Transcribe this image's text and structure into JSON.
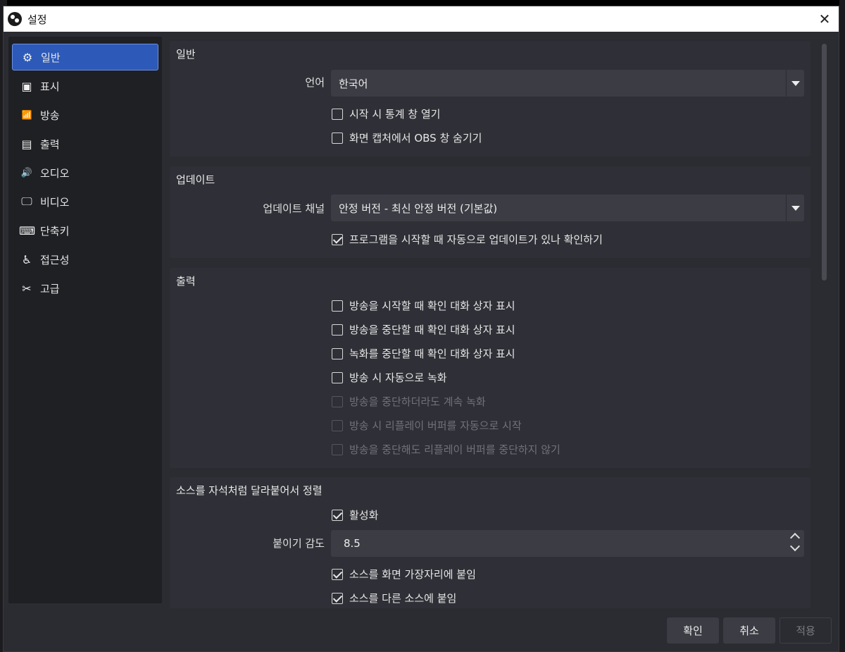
{
  "window": {
    "title": "설정",
    "close_glyph": "✕"
  },
  "sidebar": {
    "items": [
      {
        "label": "일반",
        "icon": "gear-icon",
        "glyph": "⚙",
        "active": true
      },
      {
        "label": "표시",
        "icon": "display-icon",
        "glyph": "▣",
        "active": false
      },
      {
        "label": "방송",
        "icon": "antenna-icon",
        "glyph": "📶",
        "active": false
      },
      {
        "label": "출력",
        "icon": "output-icon",
        "glyph": "▤",
        "active": false
      },
      {
        "label": "오디오",
        "icon": "speaker-icon",
        "glyph": "🔊",
        "active": false
      },
      {
        "label": "비디오",
        "icon": "monitor-icon",
        "glyph": "🖵",
        "active": false
      },
      {
        "label": "단축키",
        "icon": "keyboard-icon",
        "glyph": "⌨",
        "active": false
      },
      {
        "label": "접근성",
        "icon": "accessibility-icon",
        "glyph": "♿",
        "active": false
      },
      {
        "label": "고급",
        "icon": "tools-icon",
        "glyph": "✂",
        "active": false
      }
    ]
  },
  "general": {
    "title": "일반",
    "language_label": "언어",
    "language_value": "한국어",
    "options": [
      {
        "label": "시작 시 통계 창 열기",
        "checked": false
      },
      {
        "label": "화면 캡처에서 OBS 창 숨기기",
        "checked": false
      }
    ]
  },
  "update": {
    "title": "업데이트",
    "channel_label": "업데이트 채널",
    "channel_value": "안정 버전 - 최신 안정 버전 (기본값)",
    "options": [
      {
        "label": "프로그램을 시작할 때 자동으로 업데이트가 있나 확인하기",
        "checked": true
      }
    ]
  },
  "output": {
    "title": "출력",
    "options": [
      {
        "label": "방송을 시작할 때 확인 대화 상자 표시",
        "checked": false,
        "disabled": false
      },
      {
        "label": "방송을 중단할 때 확인 대화 상자 표시",
        "checked": false,
        "disabled": false
      },
      {
        "label": "녹화를 중단할 때 확인 대화 상자 표시",
        "checked": false,
        "disabled": false
      },
      {
        "label": "방송 시 자동으로 녹화",
        "checked": false,
        "disabled": false
      },
      {
        "label": "방송을 중단하더라도 계속 녹화",
        "checked": false,
        "disabled": true
      },
      {
        "label": "방송 시 리플레이 버퍼를 자동으로 시작",
        "checked": false,
        "disabled": true
      },
      {
        "label": "방송을 중단해도 리플레이 버퍼를 중단하지 않기",
        "checked": false,
        "disabled": true
      }
    ]
  },
  "snapping": {
    "title": "소스를 자석처럼 달라붙어서 정렬",
    "enable_label": "활성화",
    "enable_checked": true,
    "sensitivity_label": "붙이기 감도",
    "sensitivity_value": "8.5",
    "options": [
      {
        "label": "소스를 화면 가장자리에 붙임",
        "checked": true
      },
      {
        "label": "소스를 다른 소스에 붙임",
        "checked": true
      }
    ]
  },
  "buttons": {
    "ok": "확인",
    "cancel": "취소",
    "apply": "적용"
  },
  "colors": {
    "accent": "#2d5ab8",
    "background": "#2b2c32",
    "panel": "#2f3037"
  }
}
